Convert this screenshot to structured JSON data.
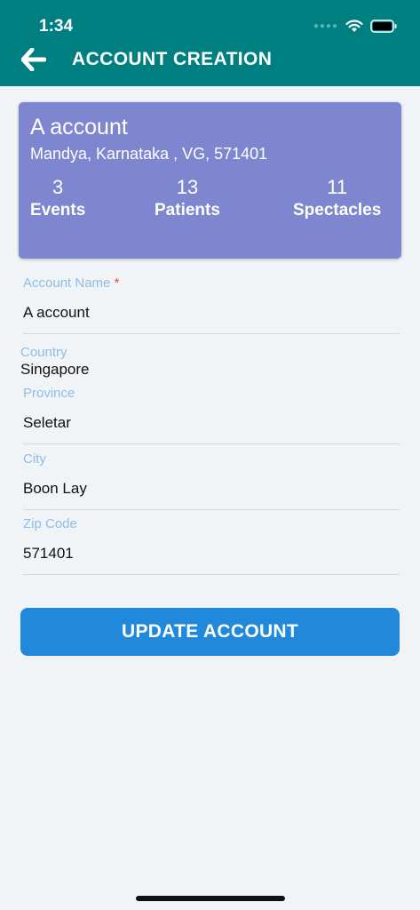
{
  "status_bar": {
    "time": "1:34"
  },
  "header": {
    "title": "ACCOUNT CREATION"
  },
  "card": {
    "name": "A account",
    "address": "Mandya, Karnataka , VG, 571401",
    "stats": [
      {
        "value": "3",
        "label": "Events"
      },
      {
        "value": "13",
        "label": "Patients"
      },
      {
        "value": "11",
        "label": "Spectacles"
      }
    ]
  },
  "form": {
    "account_name": {
      "label": "Account Name",
      "required_mark": "*",
      "value": "A account"
    },
    "country": {
      "label": "Country",
      "value": "Singapore"
    },
    "province": {
      "label": "Province",
      "value": "Seletar"
    },
    "city": {
      "label": "City",
      "value": "Boon Lay"
    },
    "zip": {
      "label": "Zip Code",
      "value": "571401"
    }
  },
  "update_button": {
    "label": "UPDATE ACCOUNT"
  },
  "colors": {
    "header": "#007f80",
    "card": "#7d86cf",
    "button": "#2189dc",
    "label": "#8ebde6"
  }
}
